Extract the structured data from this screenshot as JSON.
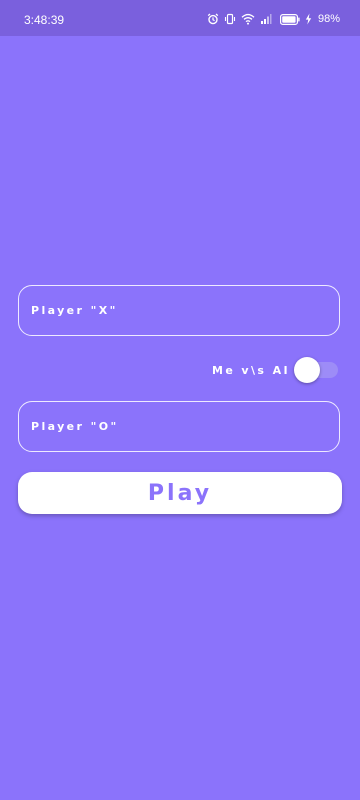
{
  "status_bar": {
    "time": "3:48:39",
    "battery_percent": "98%",
    "icons": [
      "alarm-icon",
      "vibrate-icon",
      "wifi-icon",
      "signal-icon",
      "battery-icon",
      "charging-icon"
    ]
  },
  "form": {
    "player_x_placeholder": "Player \"X\"",
    "player_o_placeholder": "Player \"O\"",
    "ai_toggle_label": "Me v\\s AI",
    "ai_toggle_on": false,
    "play_label": "Play"
  },
  "colors": {
    "background": "#8b73fb",
    "status_bar": "#7a60dd",
    "accent_text": "#8b73fb",
    "button_bg": "#ffffff"
  }
}
